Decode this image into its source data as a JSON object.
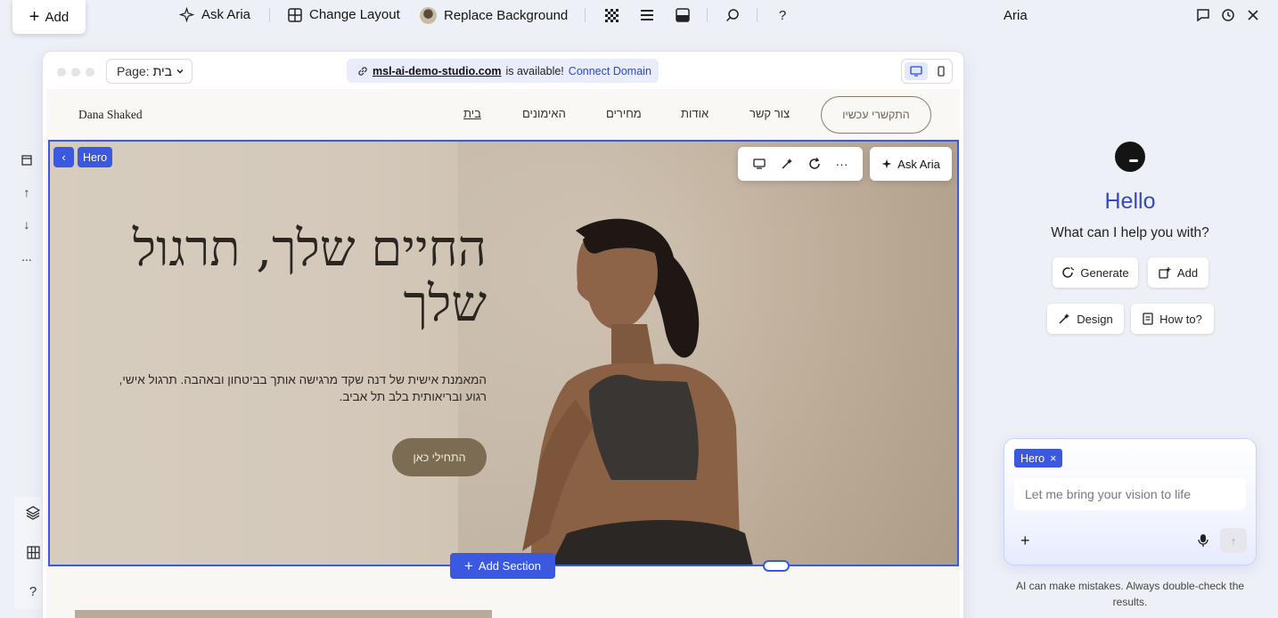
{
  "toolbar": {
    "add_label": "Add",
    "ask_aria_label": "Ask Aria",
    "change_layout_label": "Change Layout",
    "replace_background_label": "Replace Background",
    "help_label": "?"
  },
  "aria_panel": {
    "title": "Aria",
    "greeting": "Hello",
    "prompt": "What can I help you with?",
    "chips": [
      "Generate",
      "Add",
      "Design",
      "How to?"
    ],
    "context_tag": "Hero",
    "input_placeholder": "Let me bring your vision to life",
    "disclaimer": "AI can make mistakes. Always double-check the results."
  },
  "frame": {
    "page_prefix": "Page:",
    "page_value": "בית",
    "domain": "msl-ai-demo-studio.com",
    "domain_status": "is available!",
    "connect_label": "Connect Domain"
  },
  "site": {
    "logo": "Dana Shaked",
    "nav": [
      "בית",
      "האימונים",
      "מחירים",
      "אודות",
      "צור קשר"
    ],
    "nav_cta": "התקשרי עכשיו",
    "hero": {
      "title": "החיים שלך, תרגול שלך",
      "subtitle": "המאמנת אישית של דנה שקד מרגישה אותך בביטחון ובאהבה. תרגול אישי, רגוע ובריאותית בלב תל אביב.",
      "cta": "התחילי כאן"
    }
  },
  "editor": {
    "section_tag": "Hero",
    "ask_aria_float": "Ask Aria",
    "add_section": "Add Section",
    "left_more": "..."
  },
  "colors": {
    "accent": "#3b59e0",
    "hero_cta": "#7d6c54",
    "aria_hello": "#3448c9"
  }
}
